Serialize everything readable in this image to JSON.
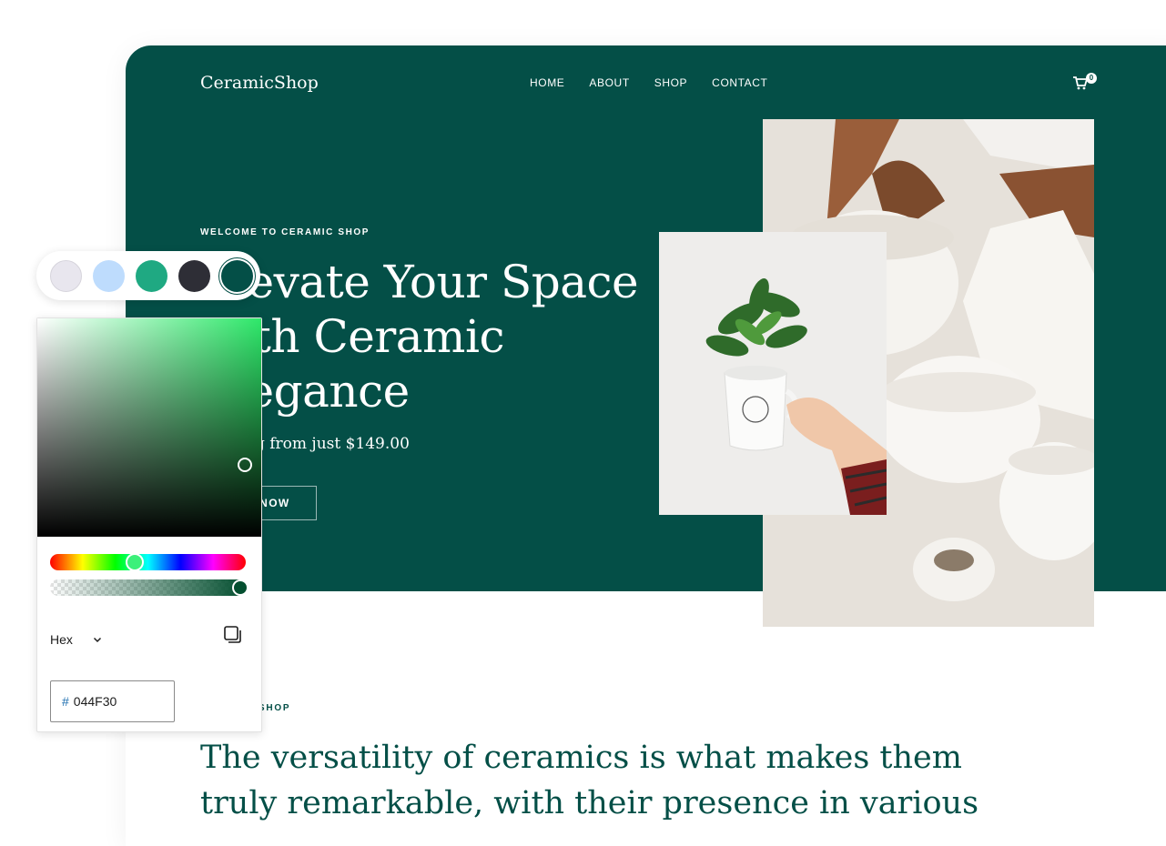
{
  "site": {
    "logo": "CeramicShop",
    "nav": [
      "HOME",
      "ABOUT",
      "SHOP",
      "CONTACT"
    ],
    "cart_count": "0",
    "hero": {
      "eyebrow": "WELCOME TO CERAMIC SHOP",
      "title": "Elevate Your Space with Ceramic Elegance",
      "price": "Starting from just $149.00",
      "cta": "SHOP NOW"
    },
    "section": {
      "eyebrow": "CERAMIC SHOP",
      "heading": "The versatility of ceramics is what makes them truly remarkable, with their presence in various"
    }
  },
  "palette": {
    "swatches": [
      {
        "name": "light-gray",
        "color": "#e8e6ee"
      },
      {
        "name": "light-blue",
        "color": "#bedcfd"
      },
      {
        "name": "teal",
        "color": "#1fa982"
      },
      {
        "name": "charcoal",
        "color": "#2e2e36"
      },
      {
        "name": "dark-green",
        "color": "#044f47",
        "selected": true
      }
    ]
  },
  "picker": {
    "format": "Hex",
    "hex_prefix": "#",
    "hex_value": "044F30",
    "hue_color": "#2ee86a",
    "alpha": 1
  }
}
